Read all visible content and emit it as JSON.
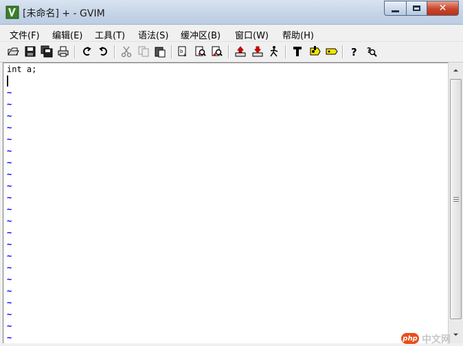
{
  "window": {
    "title": "[未命名] + - GVIM",
    "close_glyph": "✕"
  },
  "menu": [
    {
      "label": "文件(F)"
    },
    {
      "label": "编辑(E)"
    },
    {
      "label": "工具(T)"
    },
    {
      "label": "语法(S)"
    },
    {
      "label": "缓冲区(B)"
    },
    {
      "label": "窗口(W)"
    },
    {
      "label": "帮助(H)"
    }
  ],
  "toolbar": {
    "icons": [
      "open-icon",
      "save-icon",
      "save-all-icon",
      "print-icon",
      "undo-icon",
      "redo-icon",
      "cut-icon",
      "copy-icon",
      "paste-icon",
      "load-session-icon",
      "find-replace-icon",
      "find-next-icon",
      "upload-icon",
      "download-icon",
      "run-script-icon",
      "make-icon",
      "build-tags-icon",
      "jump-tag-icon",
      "help-icon",
      "find-help-icon"
    ]
  },
  "editor": {
    "lines": [
      "int a;"
    ],
    "tilde": "~",
    "tilde_count": 22
  },
  "watermark": {
    "badge": "php",
    "text": "中文网"
  }
}
